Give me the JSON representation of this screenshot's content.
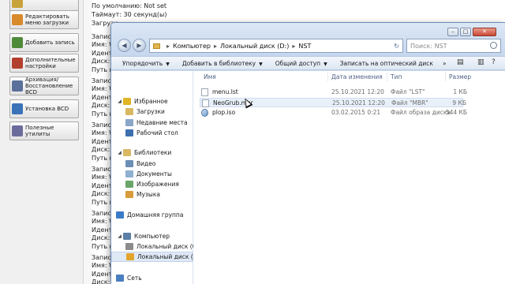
{
  "background_app": {
    "side_buttons": [
      {
        "label": "Редактировать меню загрузки",
        "color": "#d98a2b"
      },
      {
        "label": "Добавить запись",
        "color": "#4f8a3a"
      },
      {
        "label": "Дополнительные настройки",
        "color": "#b3402e"
      },
      {
        "label": "Архивация/Восстановление BCD",
        "color": "#5a6f9a"
      },
      {
        "label": "Установка BCD",
        "color": "#3b72b8"
      },
      {
        "label": "Полезные утилиты",
        "color": "#6c6c9c"
      }
    ],
    "text_lines": [
      "По умолчанию: Not set",
      "Таймаут: 30 секунд(ы)",
      "Загрузи",
      "Запис",
      "Имя: W",
      "Иденти",
      "Диск: D",
      "Путь к",
      "Запис",
      "Имя: W",
      "Иденти",
      "Диск: D",
      "Путь к",
      "Запис",
      "Имя: W",
      "Иденти",
      "Диск: D",
      "Путь к",
      "Запис",
      "Имя: W",
      "Иденти",
      "Диск: D",
      "Путь к",
      "Запис",
      "Имя: W",
      "Иденти",
      "Диск: D",
      "Путь к",
      "Запис",
      "Имя: W",
      "Иденти",
      "Диск: D"
    ]
  },
  "explorer": {
    "address": {
      "parts": [
        "Компьютер",
        "Локальный диск (D:)",
        "NST"
      ]
    },
    "search": {
      "placeholder": "Поиск: NST"
    },
    "window_controls": [
      "–",
      "□",
      "✕"
    ],
    "toolbar": [
      {
        "label": "Упорядочить",
        "has_arrow": true
      },
      {
        "label": "Добавить в библиотеку",
        "has_arrow": true
      },
      {
        "label": "Общий доступ",
        "has_arrow": true
      },
      {
        "label": "Записать на оптический диск",
        "has_arrow": false
      }
    ],
    "toolbar_more": "»",
    "nav": [
      {
        "label": "Избранное",
        "icon": "star-icon",
        "color": "#e0b423",
        "level": 0,
        "expand": "◢"
      },
      {
        "label": "Загрузки",
        "icon": "downloads-folder-icon",
        "color": "#d9b862",
        "level": 1
      },
      {
        "label": "Недавние места",
        "icon": "recent-places-icon",
        "color": "#8aa6c8",
        "level": 1
      },
      {
        "label": "Рабочий стол",
        "icon": "desktop-icon",
        "color": "#3d6fb0",
        "level": 1
      },
      {
        "label": "Библиотеки",
        "icon": "library-icon",
        "color": "#d9b862",
        "level": 0,
        "expand": "◢"
      },
      {
        "label": "Видео",
        "icon": "video-icon",
        "color": "#6b8fb5",
        "level": 1
      },
      {
        "label": "Документы",
        "icon": "documents-icon",
        "color": "#8eb0d1",
        "level": 1
      },
      {
        "label": "Изображения",
        "icon": "pictures-icon",
        "color": "#6aa56a",
        "level": 1
      },
      {
        "label": "Музыка",
        "icon": "music-icon",
        "color": "#d99b3b",
        "level": 1
      },
      {
        "label": "Домашняя группа",
        "icon": "homegroup-icon",
        "color": "#3a7bc8",
        "level": 0
      },
      {
        "label": "Компьютер",
        "icon": "computer-icon",
        "color": "#5c7fa6",
        "level": 0,
        "expand": "◢"
      },
      {
        "label": "Локальный диск (C",
        "icon": "drive-c-icon",
        "color": "#8c8c8c",
        "level": 1
      },
      {
        "label": "Локальный диск (D",
        "icon": "drive-d-icon",
        "color": "#e2a52c",
        "level": 1,
        "selected": true
      },
      {
        "label": "Сеть",
        "icon": "network-icon",
        "color": "#4a7fbf",
        "level": 0
      }
    ],
    "columns": [
      "Имя",
      "Дата изменения",
      "Тип",
      "Размер"
    ],
    "files": [
      {
        "name": "menu.lst",
        "date": "25.10.2021 12:20",
        "type": "Файл \"LST\"",
        "size": "1 КБ",
        "icon": "file-icon"
      },
      {
        "name": "NeoGrub.mbr",
        "date": "25.10.2021 12:20",
        "type": "Файл \"MBR\"",
        "size": "9 КБ",
        "icon": "file-icon",
        "hover": true
      },
      {
        "name": "plop.iso",
        "date": "03.02.2015 0:21",
        "type": "Файл образа диска",
        "size": "544 КБ",
        "icon": "disc-image-icon"
      }
    ]
  }
}
